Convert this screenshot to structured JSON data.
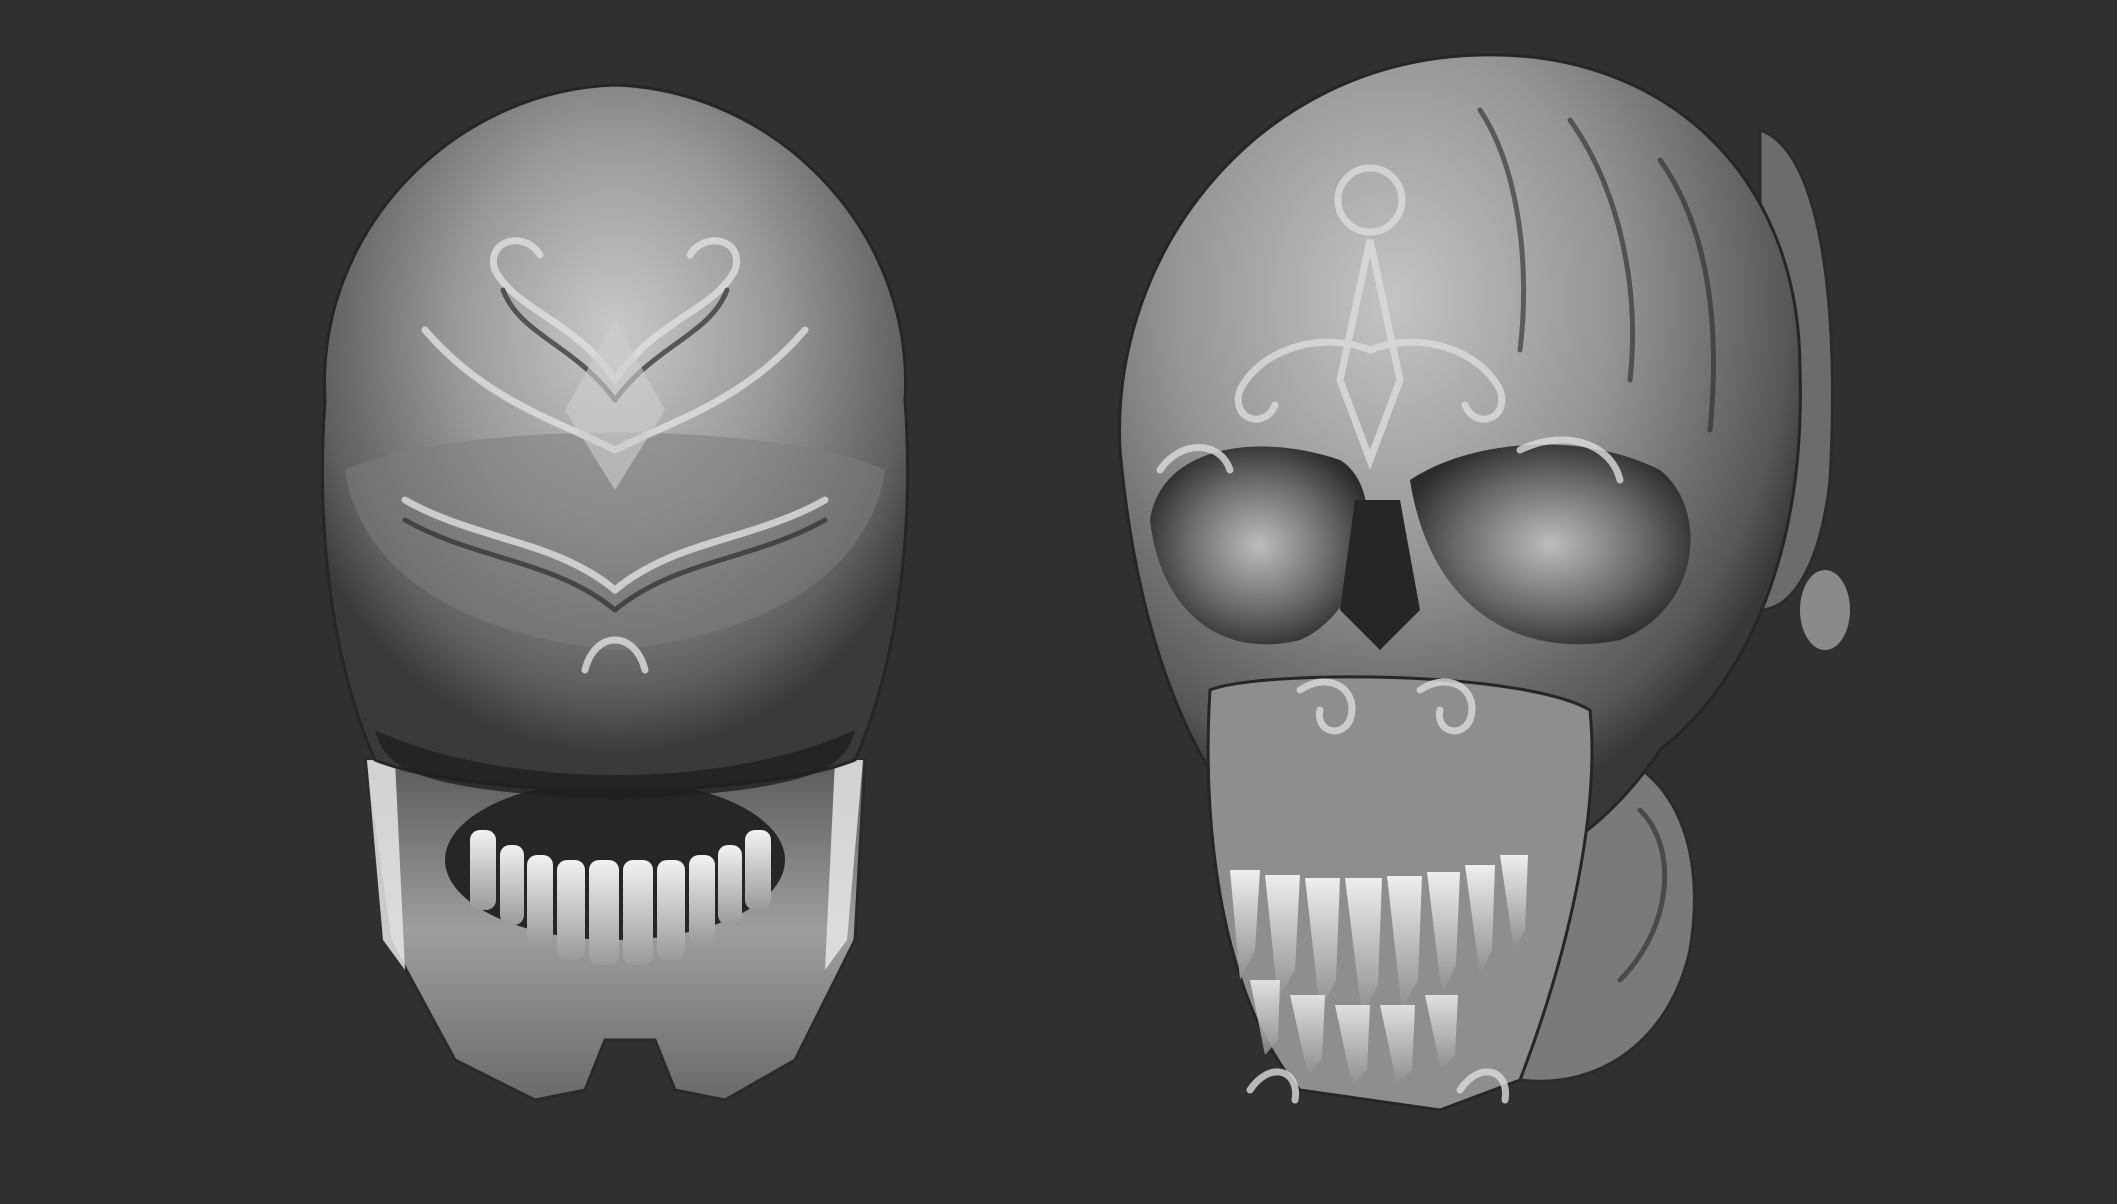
{
  "scene": {
    "background_color": "#303030",
    "material_color": "#8c8c8c",
    "highlight_color": "#dcdcdc",
    "shadow_color": "#1e1e1e",
    "objects": [
      {
        "name": "skull-top-view",
        "icon": "skull-sculpt"
      },
      {
        "name": "skull-front-three-quarter-view",
        "icon": "skull-sculpt"
      }
    ]
  }
}
